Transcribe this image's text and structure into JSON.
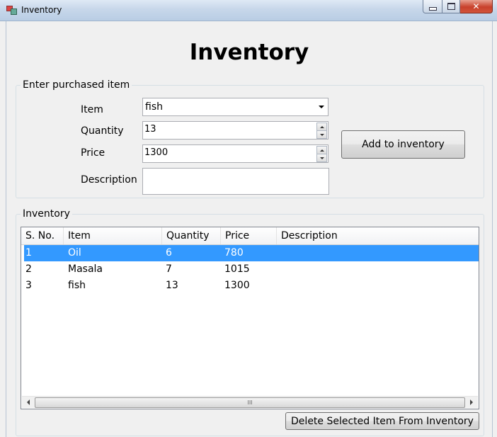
{
  "window": {
    "title": "Inventory"
  },
  "form": {
    "heading": "Inventory",
    "entry_group": {
      "legend": "Enter purchased item",
      "item_label": "Item",
      "item_value": "fish",
      "quantity_label": "Quantity",
      "quantity_value": "13",
      "price_label": "Price",
      "price_value": "1300",
      "description_label": "Description",
      "description_value": "",
      "add_button": "Add to inventory"
    },
    "list_group": {
      "legend": "Inventory",
      "columns": [
        "S. No.",
        "Item",
        "Quantity",
        "Price",
        "Description"
      ],
      "rows": [
        {
          "sno": "1",
          "item": "Oil",
          "quantity": "6",
          "price": "780",
          "description": "",
          "selected": true
        },
        {
          "sno": "2",
          "item": "Masala",
          "quantity": "7",
          "price": "1015",
          "description": "",
          "selected": false
        },
        {
          "sno": "3",
          "item": "fish",
          "quantity": "13",
          "price": "1300",
          "description": "",
          "selected": false
        }
      ],
      "scroll_grip": "III",
      "delete_button": "Delete Selected Item From Inventory"
    }
  },
  "colors": {
    "selection": "#3399ff",
    "close_button": "#c8412c"
  }
}
